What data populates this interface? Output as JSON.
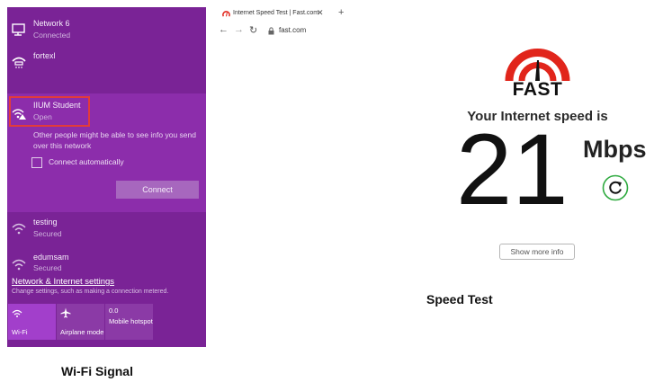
{
  "wifi_flyout": {
    "networks": [
      {
        "name": "Network 6",
        "status": "Connected",
        "icon": "ethernet-monitor-icon"
      },
      {
        "name": "fortexl",
        "status": "",
        "icon": "dialup-icon"
      },
      {
        "name": "IIUM Student",
        "status": "Open",
        "icon": "wifi-warning-icon"
      },
      {
        "name": "testing",
        "status": "Secured",
        "icon": "wifi-icon"
      },
      {
        "name": "edumsam",
        "status": "Secured",
        "icon": "wifi-icon"
      }
    ],
    "open_network": {
      "warning": "Other people might be able to see info you send over this network",
      "auto_connect_label": "Connect automatically",
      "auto_connect_checked": false,
      "connect_label": "Connect"
    },
    "settings_link": "Network & Internet settings",
    "settings_description": "Change settings, such as making a connection metered.",
    "quick_actions": [
      {
        "label": "Wi-Fi",
        "icon": "wifi-icon",
        "active": true
      },
      {
        "label": "Airplane mode",
        "icon": "airplane-icon",
        "active": false
      },
      {
        "count": "0.0",
        "label_lines": "Mobile hotspot",
        "active": false
      }
    ],
    "colors": {
      "panel": "#7a2396",
      "open_row": "#8c2dab",
      "highlight": "#e23b3b"
    }
  },
  "browser": {
    "tab_title": "Internet Speed Test | Fast.com",
    "url": "fast.com"
  },
  "speed_test": {
    "logo_text": "FAST",
    "caption": "Your Internet speed is",
    "value": "21",
    "unit": "Mbps",
    "more_info_label": "Show more info",
    "accent_color": "#e1251b"
  },
  "captions": {
    "speed_test": "Speed Test",
    "wifi": "Wi-Fi Signal"
  }
}
